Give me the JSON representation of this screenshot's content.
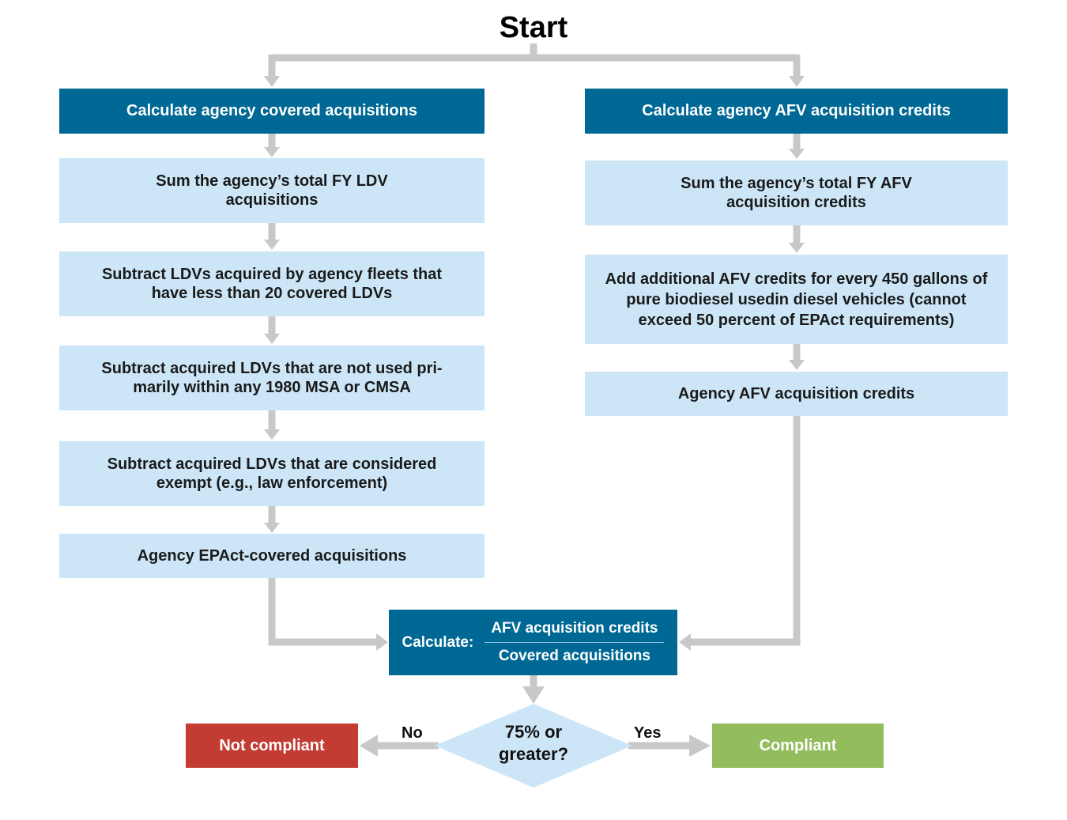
{
  "title": "Start",
  "left_column": {
    "header": "Calculate agency covered acquisitions",
    "steps": [
      "Sum the agency’s total FY LDV acquisitions",
      "Subtract LDVs acquired by agency fleets that have less than 20 covered LDVs",
      "Subtract acquired LDVs that are not used pri-marily within any 1980 MSA or CMSA",
      "Subtract acquired LDVs that are considered exempt (e.g., law enforcement)",
      "Agency EPAct-covered acquisitions"
    ]
  },
  "right_column": {
    "header": "Calculate agency AFV acquisition credits",
    "steps": [
      "Sum the agency’s total FY AFV acquisition credits",
      "Add additional AFV credits for every 450 gallons of pure biodiesel usedin diesel vehicles (cannot exceed 50 percent of EPAct requirements)",
      "Agency AFV acquisition credits"
    ]
  },
  "calculate": {
    "label": "Calculate:",
    "numerator": "AFV acquisition credits",
    "denominator": "Covered acquisitions"
  },
  "decision": {
    "question": "75% or greater?",
    "no_label": "No",
    "yes_label": "Yes"
  },
  "outcomes": {
    "not_compliant": "Not compliant",
    "compliant": "Compliant"
  },
  "colors": {
    "header_blue": "#006894",
    "step_blue": "#cde6f7",
    "connector_gray": "#c8c8c8",
    "not_compliant_red": "#c23c33",
    "compliant_green": "#93bc5c"
  }
}
